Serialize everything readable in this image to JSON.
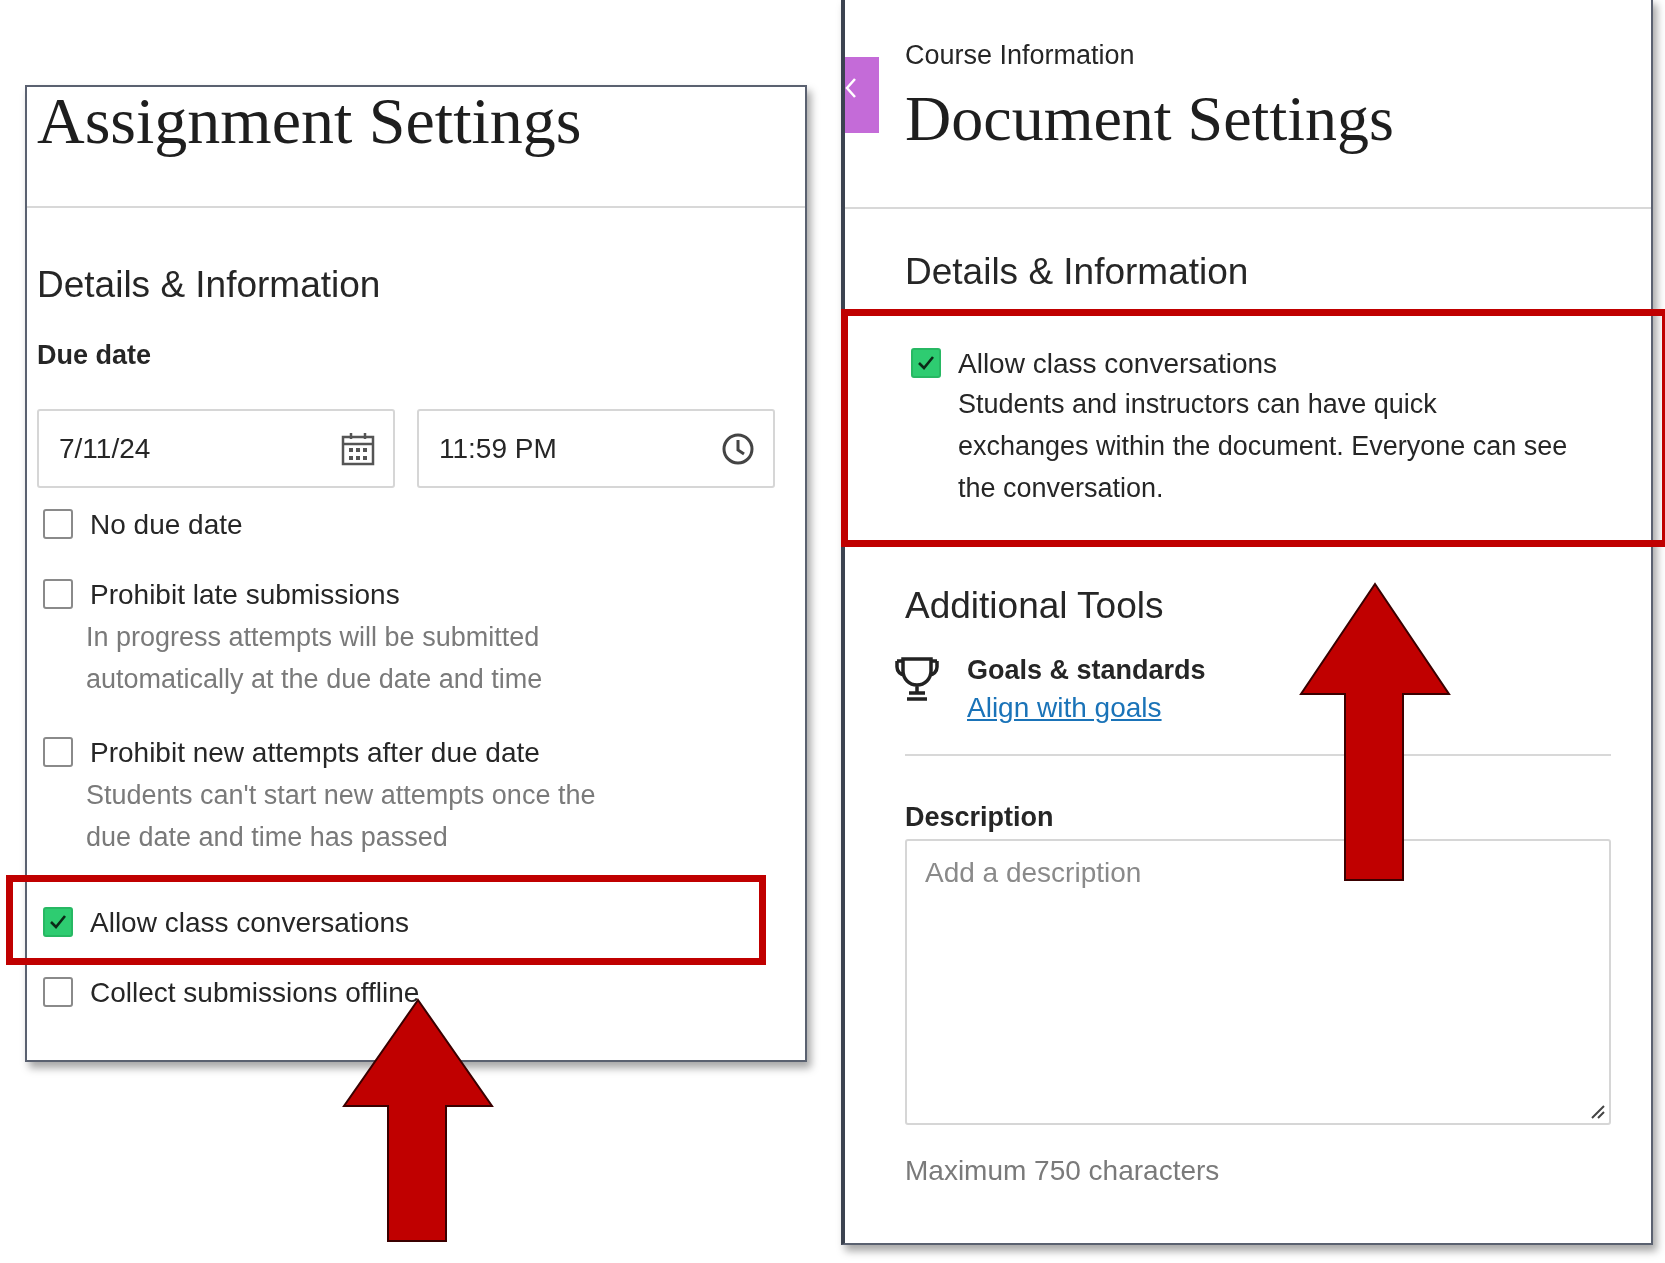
{
  "assignment_panel": {
    "title": "Assignment Settings",
    "section": "Details & Information",
    "due_date_label": "Due date",
    "date_field": {
      "value": "7/11/24"
    },
    "time_field": {
      "value": "11:59 PM"
    },
    "options": [
      {
        "label": "No due date",
        "checked": false,
        "highlighted": false
      },
      {
        "label": "Prohibit late submissions",
        "checked": false,
        "highlighted": false,
        "help": "In progress attempts will be submitted automatically at the due date and time"
      },
      {
        "label": "Prohibit new attempts after due date",
        "checked": false,
        "highlighted": false,
        "help": "Students can't start new attempts once the due date and time has passed"
      },
      {
        "label": "Allow class conversations",
        "checked": true,
        "highlighted": true
      },
      {
        "label": "Collect submissions offline",
        "checked": false,
        "highlighted": false
      }
    ]
  },
  "document_panel": {
    "breadcrumb": "Course Information",
    "title": "Document Settings",
    "section": "Details & Information",
    "option": {
      "label": "Allow class conversations",
      "checked": true,
      "highlighted": true,
      "help": "Students and instructors can have quick exchanges within the document. Everyone can see the conversation."
    },
    "tools_heading": "Additional Tools",
    "tool": {
      "name": "Goals & standards",
      "link": "Align with goals"
    },
    "description": {
      "label": "Description",
      "placeholder": "Add a description",
      "hint": "Maximum 750 characters"
    }
  }
}
